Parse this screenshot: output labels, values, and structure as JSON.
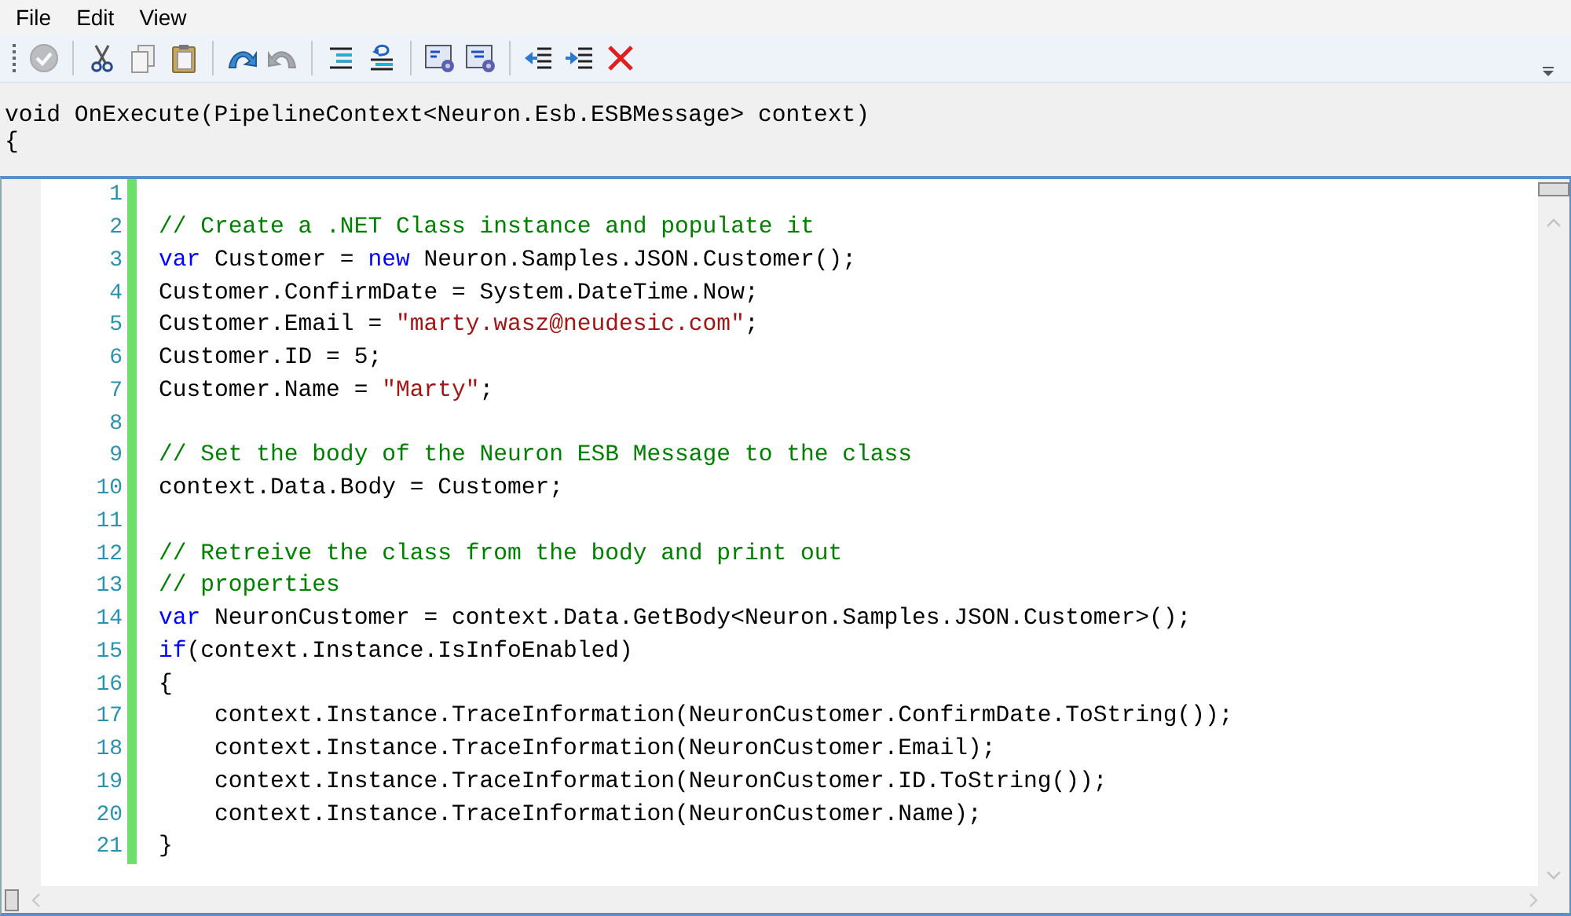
{
  "menu": [
    {
      "label": "File"
    },
    {
      "label": "Edit"
    },
    {
      "label": "View"
    }
  ],
  "toolbar": {
    "groups": [
      [
        {
          "kind": "check",
          "disabled": true
        }
      ],
      [
        {
          "kind": "cut",
          "disabled": false
        },
        {
          "kind": "copy",
          "disabled": false
        },
        {
          "kind": "paste",
          "disabled": false
        }
      ],
      [
        {
          "kind": "undo",
          "disabled": false
        },
        {
          "kind": "redo",
          "disabled": true
        }
      ],
      [
        {
          "kind": "format",
          "disabled": false
        },
        {
          "kind": "wrap",
          "disabled": false
        }
      ],
      [
        {
          "kind": "settings1",
          "disabled": false
        },
        {
          "kind": "settings2",
          "disabled": false
        }
      ],
      [
        {
          "kind": "outdent",
          "disabled": false
        },
        {
          "kind": "indent",
          "disabled": false
        },
        {
          "kind": "delete",
          "disabled": false
        }
      ]
    ]
  },
  "header": [
    "void OnExecute(PipelineContext<Neuron.Esb.ESBMessage> context)",
    "{"
  ],
  "editor": {
    "lines": [
      {
        "number": "1"
      },
      {
        "number": "2",
        "tokens": [
          {
            "kind": "comment",
            "text": "// Create a .NET Class instance and populate it"
          }
        ]
      },
      {
        "number": "3",
        "tokens": [
          {
            "kind": "keyword",
            "text": "var"
          },
          {
            "kind": "plain",
            "text": " Customer = "
          },
          {
            "kind": "keyword",
            "text": "new"
          },
          {
            "kind": "plain",
            "text": " Neuron.Samples.JSON.Customer();"
          }
        ]
      },
      {
        "number": "4",
        "tokens": [
          {
            "kind": "plain",
            "text": "Customer.ConfirmDate = System.DateTime.Now;"
          }
        ]
      },
      {
        "number": "5",
        "tokens": [
          {
            "kind": "plain",
            "text": "Customer.Email = "
          },
          {
            "kind": "string",
            "text": "\"marty.wasz@neudesic.com\""
          },
          {
            "kind": "plain",
            "text": ";"
          }
        ]
      },
      {
        "number": "6",
        "tokens": [
          {
            "kind": "plain",
            "text": "Customer.ID = 5;"
          }
        ]
      },
      {
        "number": "7",
        "tokens": [
          {
            "kind": "plain",
            "text": "Customer.Name = "
          },
          {
            "kind": "string",
            "text": "\"Marty\""
          },
          {
            "kind": "plain",
            "text": ";"
          }
        ]
      },
      {
        "number": "8"
      },
      {
        "number": "9",
        "tokens": [
          {
            "kind": "comment",
            "text": "// Set the body of the Neuron ESB Message to the class"
          }
        ]
      },
      {
        "number": "10",
        "tokens": [
          {
            "kind": "plain",
            "text": "context.Data.Body = Customer;"
          }
        ]
      },
      {
        "number": "11"
      },
      {
        "number": "12",
        "tokens": [
          {
            "kind": "comment",
            "text": "// Retreive the class from the body and print out"
          }
        ]
      },
      {
        "number": "13",
        "tokens": [
          {
            "kind": "comment",
            "text": "// properties"
          }
        ]
      },
      {
        "number": "14",
        "tokens": [
          {
            "kind": "keyword",
            "text": "var"
          },
          {
            "kind": "plain",
            "text": " NeuronCustomer = context.Data.GetBody<Neuron.Samples.JSON.Customer>();"
          }
        ]
      },
      {
        "number": "15",
        "tokens": [
          {
            "kind": "keyword",
            "text": "if"
          },
          {
            "kind": "plain",
            "text": "(context.Instance.IsInfoEnabled)"
          }
        ]
      },
      {
        "number": "16",
        "tokens": [
          {
            "kind": "plain",
            "text": "{"
          }
        ]
      },
      {
        "number": "17",
        "tokens": [
          {
            "kind": "plain",
            "text": "    context.Instance.TraceInformation(NeuronCustomer.ConfirmDate.ToString());"
          }
        ]
      },
      {
        "number": "18",
        "tokens": [
          {
            "kind": "plain",
            "text": "    context.Instance.TraceInformation(NeuronCustomer.Email);"
          }
        ]
      },
      {
        "number": "19",
        "tokens": [
          {
            "kind": "plain",
            "text": "    context.Instance.TraceInformation(NeuronCustomer.ID.ToString());"
          }
        ]
      },
      {
        "number": "20",
        "tokens": [
          {
            "kind": "plain",
            "text": "    context.Instance.TraceInformation(NeuronCustomer.Name);"
          }
        ]
      },
      {
        "number": "21",
        "tokens": [
          {
            "kind": "plain",
            "text": "}"
          }
        ]
      }
    ]
  }
}
